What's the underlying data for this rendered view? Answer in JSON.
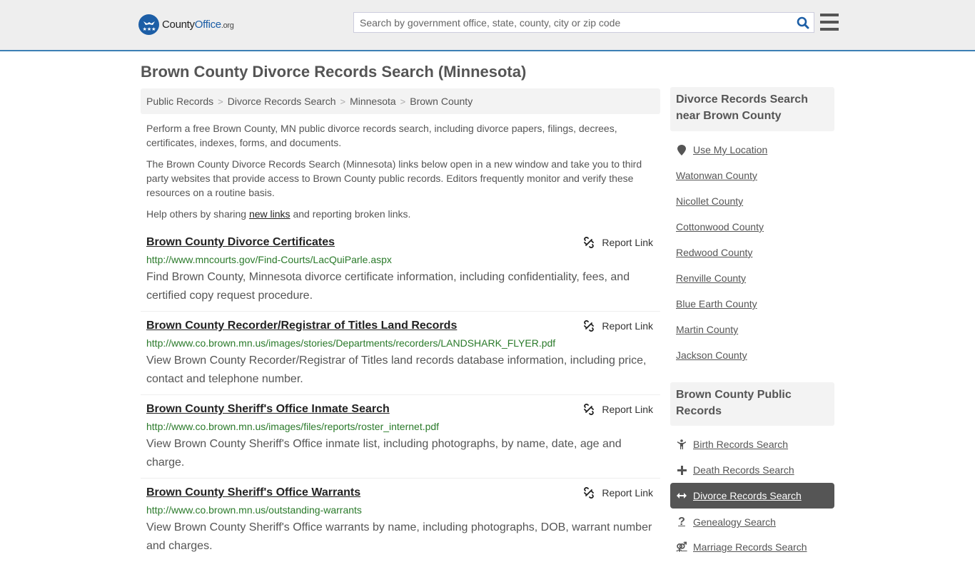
{
  "header": {
    "logo": {
      "name": "County",
      "highlight": "Office",
      "tld": ".org"
    },
    "search": {
      "placeholder": "Search by government office, state, county, city or zip code",
      "value": ""
    }
  },
  "page_title": "Brown County Divorce Records Search (Minnesota)",
  "breadcrumb": [
    "Public Records",
    "Divorce Records Search",
    "Minnesota",
    "Brown County"
  ],
  "intro": {
    "p1": "Perform a free Brown County, MN public divorce records search, including divorce papers, filings, decrees, certificates, indexes, forms, and documents.",
    "p2": "The Brown County Divorce Records Search (Minnesota) links below open in a new window and take you to third party websites that provide access to Brown County public records. Editors frequently monitor and verify these resources on a routine basis.",
    "p3_before": "Help others by sharing ",
    "p3_link": "new links",
    "p3_after": " and reporting broken links."
  },
  "results": [
    {
      "title": "Brown County Divorce Certificates",
      "url": "http://www.mncourts.gov/Find-Courts/LacQuiParle.aspx",
      "desc": "Find Brown County, Minnesota divorce certificate information, including confidentiality, fees, and certified copy request procedure.",
      "report": "Report Link"
    },
    {
      "title": "Brown County Recorder/Registrar of Titles Land Records",
      "url": "http://www.co.brown.mn.us/images/stories/Departments/recorders/LANDSHARK_FLYER.pdf",
      "desc": "View Brown County Recorder/Registrar of Titles land records database information, including price, contact and telephone number.",
      "report": "Report Link"
    },
    {
      "title": "Brown County Sheriff's Office Inmate Search",
      "url": "http://www.co.brown.mn.us/images/files/reports/roster_internet.pdf",
      "desc": "View Brown County Sheriff's Office inmate list, including photographs, by name, date, age and charge.",
      "report": "Report Link"
    },
    {
      "title": "Brown County Sheriff's Office Warrants",
      "url": "http://www.co.brown.mn.us/outstanding-warrants",
      "desc": "View Brown County Sheriff's Office warrants by name, including photographs, DOB, warrant number and charges.",
      "report": "Report Link"
    }
  ],
  "sidebar": {
    "nearby_heading": "Divorce Records Search near Brown County",
    "use_location": "Use My Location",
    "nearby": [
      "Watonwan County",
      "Nicollet County",
      "Cottonwood County",
      "Redwood County",
      "Renville County",
      "Blue Earth County",
      "Martin County",
      "Jackson County"
    ],
    "public_heading": "Brown County Public Records",
    "public_links": [
      {
        "label": "Birth Records Search",
        "icon": "child-icon"
      },
      {
        "label": "Death Records Search",
        "icon": "cross-icon"
      },
      {
        "label": "Divorce Records Search",
        "icon": "arrows-horizontal-icon",
        "active": true
      },
      {
        "label": "Genealogy Search",
        "icon": "question-icon"
      },
      {
        "label": "Marriage Records Search",
        "icon": "marriage-icon"
      }
    ]
  },
  "colors": {
    "brand": "#1c5ea6",
    "accent_border": "#3b7fb5",
    "url_green": "#2a7a2a",
    "active_bg": "#555555"
  }
}
